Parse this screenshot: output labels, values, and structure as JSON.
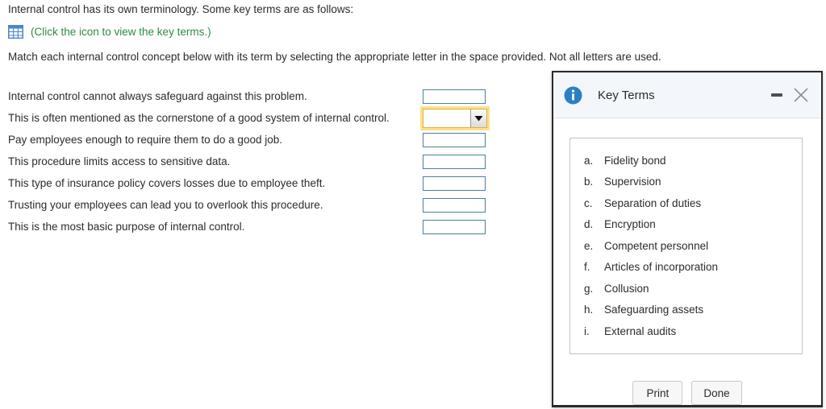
{
  "intro": {
    "line1": "Internal control has its own terminology. Some key terms are as follows:",
    "icon_name": "table-grid-icon",
    "icon_link": "(Click the icon to view the key terms.)",
    "line3": "Match each internal control concept below with its term by selecting the appropriate letter in the space provided. Not all letters are used."
  },
  "match_rows": [
    {
      "label": "Internal control cannot always safeguard against this problem.",
      "value": "",
      "focused": false
    },
    {
      "label": "This is often mentioned as the cornerstone of a good system of internal control.",
      "value": "",
      "focused": true
    },
    {
      "label": "Pay employees enough to require them to do a good job.",
      "value": "",
      "focused": false
    },
    {
      "label": "This procedure limits access to sensitive data.",
      "value": "",
      "focused": false
    },
    {
      "label": "This type of insurance policy covers losses due to employee theft.",
      "value": "",
      "focused": false
    },
    {
      "label": "Trusting your employees can lead you to overlook this procedure.",
      "value": "",
      "focused": false
    },
    {
      "label": "This is the most basic purpose of internal control.",
      "value": "",
      "focused": false
    }
  ],
  "dialog": {
    "title": "Key Terms",
    "info_icon": "info-circle-icon",
    "minimize_icon": "minimize-icon",
    "close_icon": "close-icon",
    "terms": [
      {
        "letter": "a.",
        "name": "Fidelity bond"
      },
      {
        "letter": "b.",
        "name": "Supervision"
      },
      {
        "letter": "c.",
        "name": "Separation of duties"
      },
      {
        "letter": "d.",
        "name": "Encryption"
      },
      {
        "letter": "e.",
        "name": "Competent personnel"
      },
      {
        "letter": "f.",
        "name": "Articles of incorporation"
      },
      {
        "letter": "g.",
        "name": "Collusion"
      },
      {
        "letter": "h.",
        "name": "Safeguarding assets"
      },
      {
        "letter": "i.",
        "name": "External audits"
      }
    ],
    "print_label": "Print",
    "done_label": "Done"
  },
  "colors": {
    "link_green": "#2f8b41",
    "input_border": "#4a7f9e",
    "focus_glow": "#ffe08a",
    "dialog_header": "#f3f7fb",
    "info_blue": "#2a7fc9"
  }
}
